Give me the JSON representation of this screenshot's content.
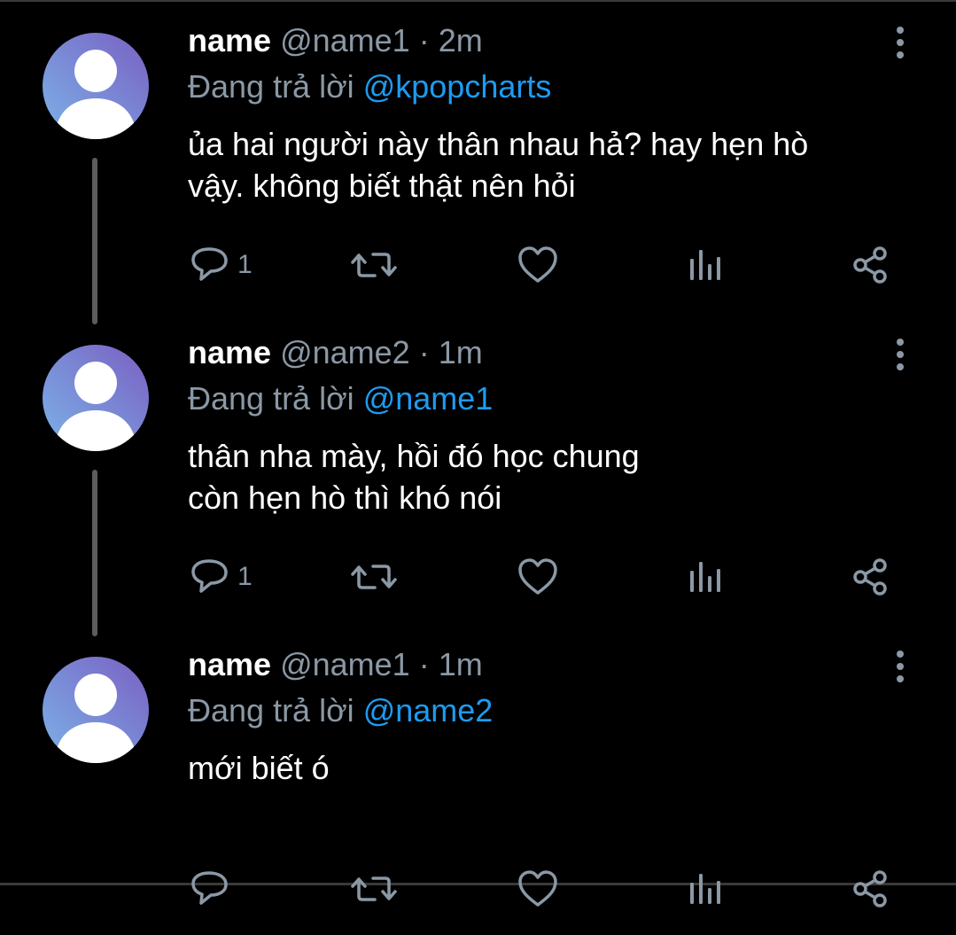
{
  "tweets": [
    {
      "display_name": "name",
      "handle": "@name1",
      "separator": "·",
      "time": "2m",
      "reply_prefix": "Đang trả lời",
      "reply_to": "@kpopcharts",
      "body_lines": [
        "ủa hai người này thân nhau hả? hay hẹn hò",
        "vậy. không biết thật nên hỏi"
      ],
      "reply_count": "1"
    },
    {
      "display_name": "name",
      "handle": "@name2",
      "separator": "·",
      "time": "1m",
      "reply_prefix": "Đang trả lời",
      "reply_to": "@name1",
      "body_lines": [
        "thân nha mày, hồi đó học chung",
        "còn hẹn hò thì khó nói"
      ],
      "reply_count": "1"
    },
    {
      "display_name": "name",
      "handle": "@name1",
      "separator": "·",
      "time": "1m",
      "reply_prefix": "Đang trả lời",
      "reply_to": "@name2",
      "body_lines": [
        "mới biết ó"
      ],
      "reply_count": ""
    }
  ],
  "icons": {
    "avatar": "default-avatar-icon",
    "more": "more-vertical-icon",
    "reply": "reply-bubble-icon",
    "retweet": "retweet-icon",
    "like": "heart-icon",
    "analytics": "analytics-bars-icon",
    "share": "share-icon"
  },
  "colors": {
    "background": "#000000",
    "primary_text": "#ffffff",
    "secondary_text": "#8b98a5",
    "mention": "#1d9bf0",
    "avatar_gradient_start": "#7bb3e8",
    "avatar_gradient_end": "#7a5fc2"
  }
}
